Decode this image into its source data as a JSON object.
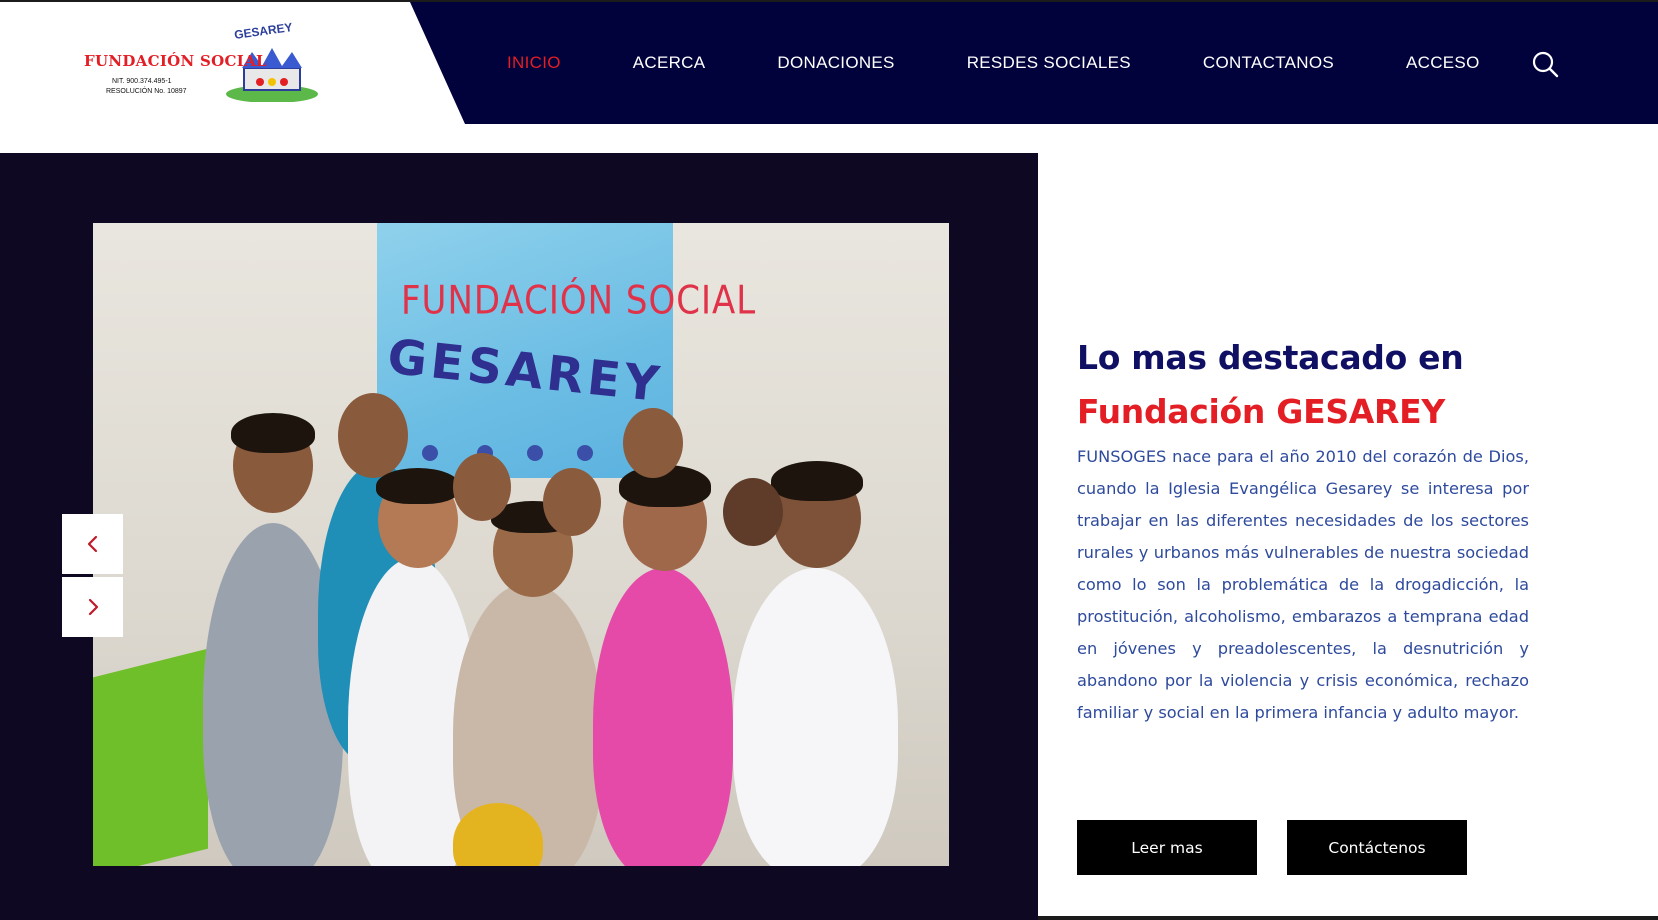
{
  "logo": {
    "name": "FUNDACIÓN SOCIAL",
    "brand": "GESAREY",
    "nit": "NIT. 900.374.495-1",
    "resolution": "RESOLUCIÓN No. 10897"
  },
  "nav": {
    "items": [
      {
        "label": "INICIO",
        "active": true
      },
      {
        "label": "ACERCA",
        "active": false
      },
      {
        "label": "DONACIONES",
        "active": false
      },
      {
        "label": "RESDES SOCIALES",
        "active": false
      },
      {
        "label": "CONTACTANOS",
        "active": false
      },
      {
        "label": "ACCESO",
        "active": false
      }
    ],
    "search_icon": "search-icon"
  },
  "hero": {
    "photo_sign": {
      "line1": "FUNDACIÓN SOCIAL",
      "line2": "GESAREY"
    },
    "prev_icon": "chevron-left-icon",
    "next_icon": "chevron-right-icon"
  },
  "feature": {
    "headline_line1": "Lo mas destacado en",
    "headline_line2": "Fundación GESAREY",
    "body": "FUNSOGES nace para el año 2010 del corazón de Dios, cuando la Iglesia Evangélica Gesarey se interesa por trabajar en las diferentes necesidades de los sectores rurales y urbanos más vulnerables de nuestra sociedad como lo son la problemática de la drogadicción, la prostitución, alcoholismo, embarazos a temprana edad en jóvenes y preadolescentes, la desnutrición y abandono por la violencia y crisis económica, rechazo familiar y social en la primera infancia y adulto mayor.",
    "read_more_label": "Leer mas",
    "contact_label": "Contáctenos"
  },
  "colors": {
    "nav_bg": "#01013c",
    "accent_red": "#e31e24",
    "headline_navy": "#0f0f63",
    "body_blue": "#2e4a9c",
    "hero_dark": "#0f0823"
  }
}
